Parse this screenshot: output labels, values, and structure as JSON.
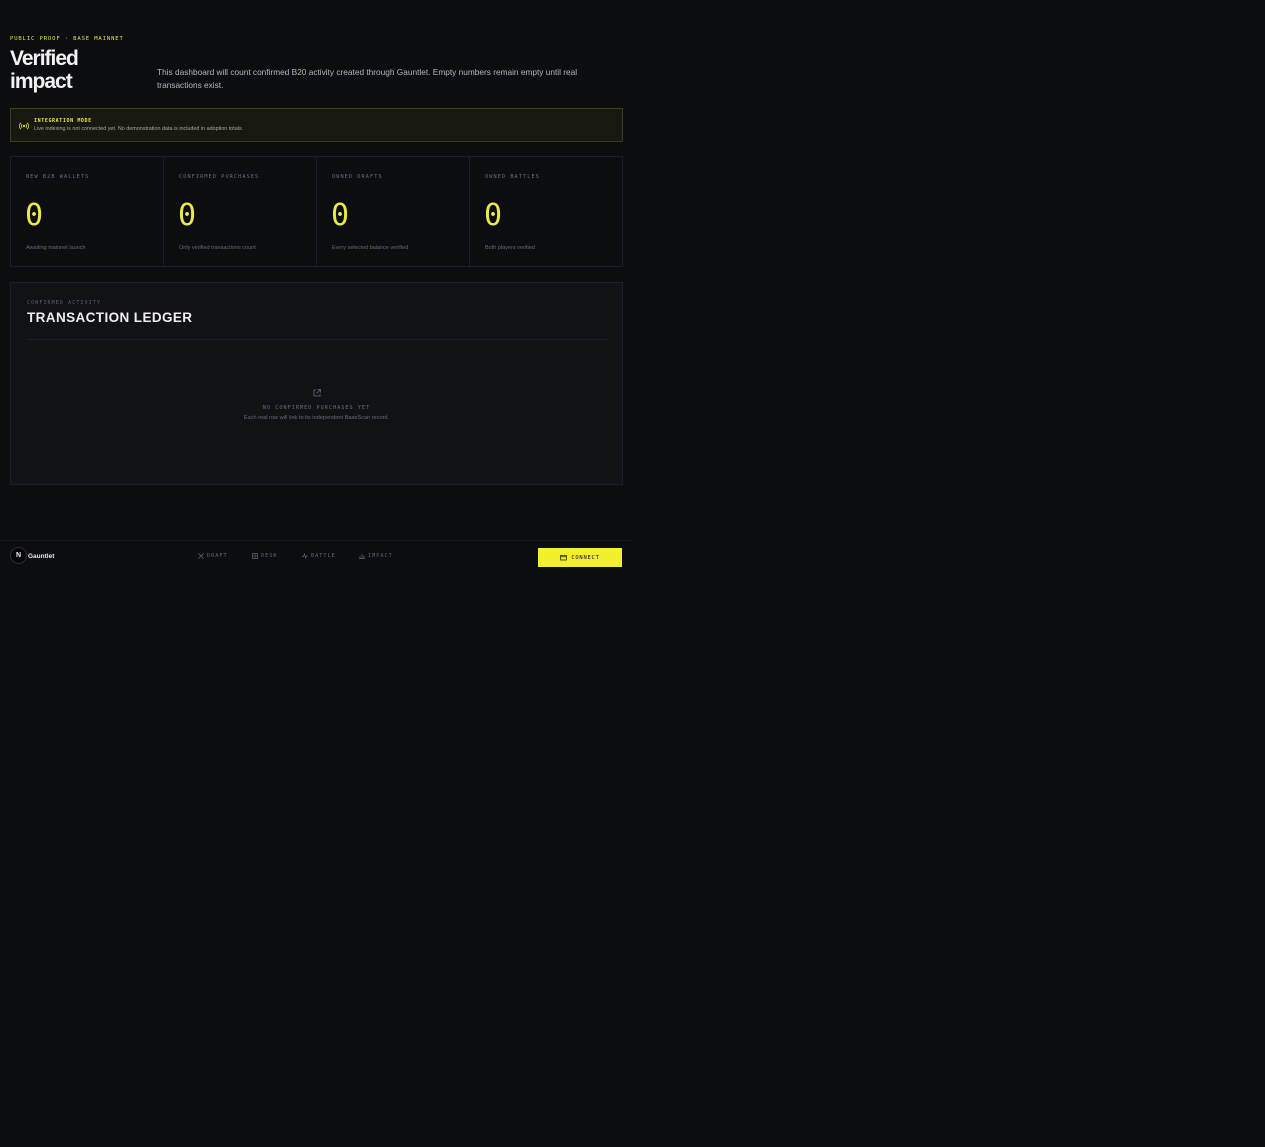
{
  "hero": {
    "eyebrow": "PUBLIC PROOF · BASE MAINNET",
    "title": "Verified impact",
    "intro": "This dashboard will count confirmed B20 activity created through Gauntlet. Empty numbers remain empty until real transactions exist."
  },
  "notice": {
    "icon": "radio-signal-icon",
    "label": "INTEGRATION MODE",
    "text": "Live indexing is not connected yet. No demonstration data is included in adoption totals."
  },
  "stats": [
    {
      "label": "NEW B2B WALLETS",
      "value": "0",
      "note": "Awaiting mainnet launch"
    },
    {
      "label": "CONFIRMED PURCHASES",
      "value": "0",
      "note": "Only verified transactions count"
    },
    {
      "label": "OWNED DRAFTS",
      "value": "0",
      "note": "Every selected balance verified"
    },
    {
      "label": "OWNED BATTLES",
      "value": "0",
      "note": "Both players verified"
    }
  ],
  "ledger": {
    "eyebrow": "CONFIRMED ACTIVITY",
    "title": "TRANSACTION LEDGER",
    "empty_icon": "external-link-icon",
    "empty_title": "NO CONFIRMED PURCHASES YET",
    "empty_text": "Each real row will link to its independent BaseScan record."
  },
  "footer": {
    "logo_letter": "N",
    "brand": "Gauntlet",
    "nav": [
      {
        "label": "DRAFT",
        "icon": "cross-swords-icon"
      },
      {
        "label": "DESK",
        "icon": "grid-icon"
      },
      {
        "label": "BATTLE",
        "icon": "pulse-icon"
      },
      {
        "label": "IMPACT",
        "icon": "bar-chart-icon"
      }
    ],
    "connect_label": "CONNECT",
    "connect_icon": "wallet-icon"
  },
  "colors": {
    "background": "#0c0d10",
    "accent": "#f2ef2c",
    "notice_bg": "#17180f",
    "panel_bg": "#111216"
  }
}
